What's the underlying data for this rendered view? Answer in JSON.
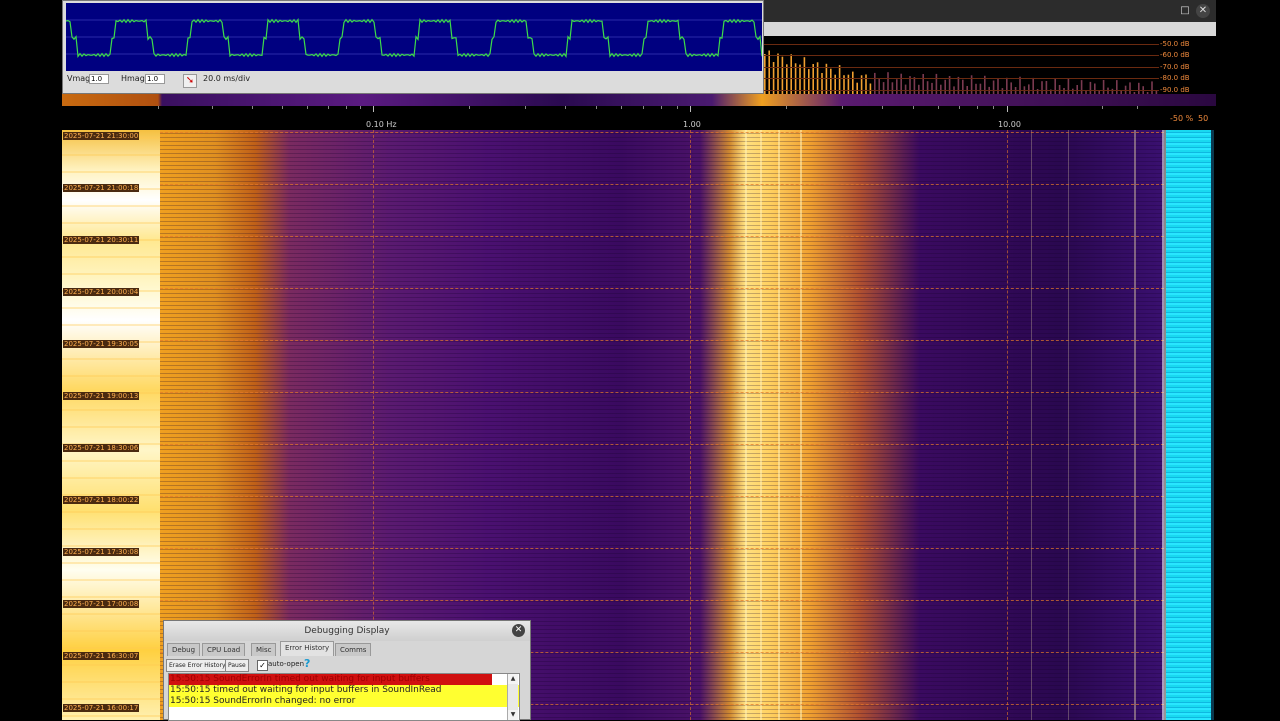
{
  "scope": {
    "vmag_label": "Vmag",
    "vmag_value": "1.0",
    "hmag_label": "Hmag",
    "hmag_value": "1.0",
    "timebase": "20.0 ms/div"
  },
  "window": {
    "maximize_glyph": "□",
    "close_glyph": "✕"
  },
  "spectrum": {
    "db_labels": [
      "-50.0 dB",
      "-60.0 dB",
      "-70.0 dB",
      "-80.0 dB",
      "-80.0 dB",
      "-90.0 dB"
    ]
  },
  "frequency_axis": {
    "labels": [
      "0.10 Hz",
      "1.00",
      "10.00"
    ]
  },
  "meter": {
    "label_left": "-50 %",
    "label_right": "50"
  },
  "waterfall": {
    "timestamps": [
      "2025-07-21 21:30:00",
      "2025-07-21 21:00:18",
      "2025-07-21 20:30:11",
      "2025-07-21 20:00:04",
      "2025-07-21 19:30:05",
      "2025-07-21 19:00:13",
      "2025-07-21 18:30:06",
      "2025-07-21 18:00:22",
      "2025-07-21 17:30:08",
      "2025-07-21 17:00:08",
      "2025-07-21 16:30:07",
      "2025-07-21 16:00:17"
    ]
  },
  "debug": {
    "title": "Debugging Display",
    "close_glyph": "✕",
    "tabs": [
      "Debug",
      "CPU Load",
      "Misc",
      "Error History",
      "Comms"
    ],
    "active_tab": "Error History",
    "erase_button": "Erase Error History",
    "pause_button": "Pause",
    "auto_open_label": "auto-open",
    "auto_open_checked": "✓",
    "help_glyph": "?",
    "lines": [
      "15:50:15 SoundErrorIn timed out waiting for input buffers",
      "15:50:15 timed out waiting for input buffers in SoundInRead",
      "15:50:15 SoundErrorIn  changed: no error"
    ]
  },
  "colors": {
    "scope_trace": "#3ddc4a",
    "scope_bg": "#000080",
    "meter": "#19d9f0",
    "accent": "#f08a3c"
  }
}
